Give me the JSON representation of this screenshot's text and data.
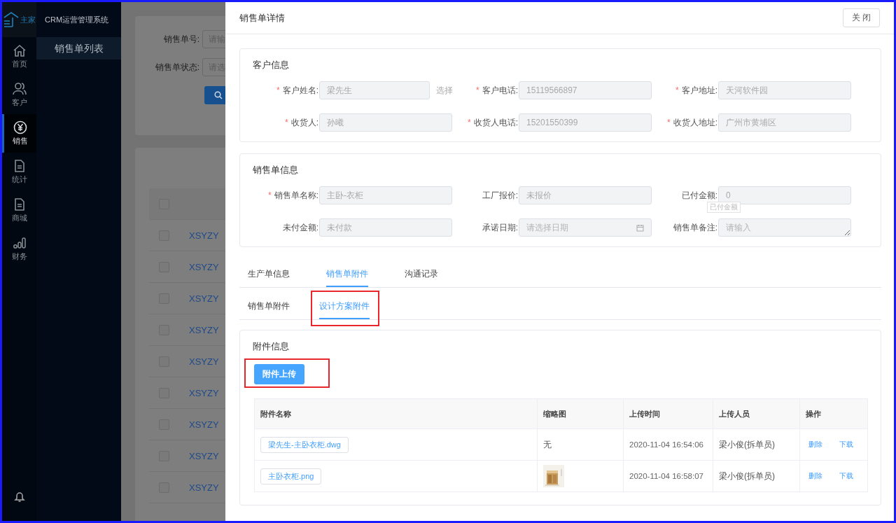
{
  "app": {
    "logo": "主家",
    "title": "CRM运营管理系统"
  },
  "nav": [
    {
      "label": "首页",
      "kind": "home",
      "selected": false
    },
    {
      "label": "客户",
      "kind": "user",
      "selected": false
    },
    {
      "label": "销售",
      "kind": "yen",
      "selected": true
    },
    {
      "label": "统计",
      "kind": "doc",
      "selected": false
    },
    {
      "label": "商城",
      "kind": "doc",
      "selected": false
    },
    {
      "label": "财务",
      "kind": "bars",
      "selected": false
    }
  ],
  "submenu": [
    {
      "label": "销售单列表",
      "selected": true
    }
  ],
  "background_page": {
    "filters": [
      {
        "label": "销售单号:",
        "placeholder": "请输"
      },
      {
        "label": "销售单状态:",
        "placeholder": "请选"
      }
    ],
    "header_checked": false,
    "rows": [
      {
        "order": "XSYZY",
        "checked": false
      },
      {
        "order": "XSYZY",
        "checked": false
      },
      {
        "order": "XSYZY",
        "checked": false
      },
      {
        "order": "XSYZY",
        "checked": false
      },
      {
        "order": "XSYZY",
        "checked": false
      },
      {
        "order": "XSYZY",
        "checked": false
      },
      {
        "order": "XSYZY",
        "checked": false
      },
      {
        "order": "XSYZY",
        "checked": false
      },
      {
        "order": "XSYZY",
        "checked": false
      }
    ]
  },
  "drawer": {
    "title": "销售单详情",
    "close_button": "关 闭",
    "sections": [
      {
        "title": "客户信息",
        "fields": [
          {
            "label": "客户姓名:",
            "required_mark": "*",
            "value": "梁先生",
            "kind": "select",
            "action": "选择"
          },
          {
            "label": "客户电话:",
            "required_mark": "*",
            "value": "15119566897",
            "kind": "input"
          },
          {
            "label": "客户地址:",
            "required_mark": "*",
            "value": "天河软件园",
            "kind": "input"
          },
          {
            "label": "收货人:",
            "required_mark": "*",
            "value": "孙曦",
            "kind": "input"
          },
          {
            "label": "收货人电话:",
            "required_mark": "*",
            "value": "15201550399",
            "kind": "input"
          },
          {
            "label": "收货人地址:",
            "required_mark": "*",
            "value": "广州市黄埔区",
            "kind": "input"
          }
        ]
      },
      {
        "title": "销售单信息",
        "fields": [
          {
            "label": "销售单名称:",
            "required_mark": "*",
            "value": "主卧-衣柜",
            "kind": "input"
          },
          {
            "label": "工厂报价:",
            "value": "未报价",
            "kind": "input"
          },
          {
            "label": "已付金额:",
            "value": "0",
            "kind": "input",
            "tooltip": "已付金额"
          },
          {
            "label": "未付金额:",
            "value": "未付款",
            "kind": "input"
          },
          {
            "label": "承诺日期:",
            "placeholder": "请选择日期",
            "kind": "date"
          },
          {
            "label": "销售单备注:",
            "placeholder": "请输入",
            "kind": "textarea"
          }
        ]
      }
    ],
    "tabs": [
      {
        "label": "生产单信息",
        "selected": false
      },
      {
        "label": "销售单附件",
        "selected": true
      },
      {
        "label": "沟通记录",
        "selected": false
      }
    ],
    "subtabs": [
      {
        "label": "销售单附件",
        "selected": false,
        "highlighted": false
      },
      {
        "label": "设计方案附件",
        "selected": true,
        "highlighted": true
      }
    ],
    "attachments": {
      "title": "附件信息",
      "upload_button": "附件上传",
      "upload_highlighted": true,
      "columns": [
        "附件名称",
        "缩略图",
        "上传时间",
        "上传人员",
        "操作"
      ],
      "rows": [
        {
          "name": "梁先生-主卧衣柜.dwg",
          "thumbnail": {
            "kind": "text",
            "text": "无"
          },
          "time": "2020-11-04 16:54:06",
          "uploader": "梁小俊(拆单员)",
          "actions": [
            "删除",
            "下载"
          ]
        },
        {
          "name": "主卧衣柜.png",
          "thumbnail": {
            "kind": "picture"
          },
          "time": "2020-11-04 16:58:07",
          "uploader": "梁小俊(拆单员)",
          "actions": [
            "删除",
            "下载"
          ]
        }
      ]
    }
  }
}
